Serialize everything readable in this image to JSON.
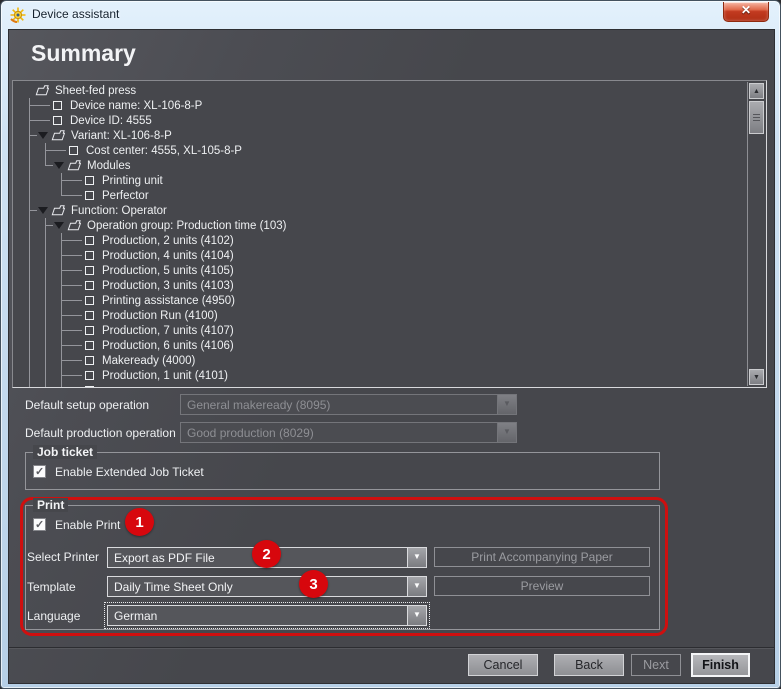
{
  "window": {
    "title": "Device assistant"
  },
  "heading": "Summary",
  "tree": {
    "items": [
      {
        "label": "Sheet-fed press",
        "level": 0,
        "icon": "folder",
        "arrow": false
      },
      {
        "label": "Device name: XL-106-8-P",
        "level": 1,
        "icon": "checkbox",
        "arrow": false
      },
      {
        "label": "Device ID: 4555",
        "level": 1,
        "icon": "checkbox",
        "arrow": false
      },
      {
        "label": "Variant: XL-106-8-P",
        "level": 1,
        "icon": "folder",
        "arrow": true
      },
      {
        "label": "Cost center: 4555, XL-105-8-P",
        "level": 2,
        "icon": "checkbox",
        "arrow": false
      },
      {
        "label": "Modules",
        "level": 2,
        "icon": "folder",
        "arrow": true
      },
      {
        "label": "Printing unit",
        "level": 3,
        "icon": "checkbox",
        "arrow": false
      },
      {
        "label": "Perfector",
        "level": 3,
        "icon": "checkbox",
        "arrow": false
      },
      {
        "label": "Function: Operator",
        "level": 1,
        "icon": "folder",
        "arrow": true
      },
      {
        "label": "Operation group: Production time (103)",
        "level": 2,
        "icon": "folder",
        "arrow": true
      },
      {
        "label": "Production, 2 units (4102)",
        "level": 3,
        "icon": "checkbox",
        "arrow": false
      },
      {
        "label": "Production, 4 units (4104)",
        "level": 3,
        "icon": "checkbox",
        "arrow": false
      },
      {
        "label": "Production, 5 units (4105)",
        "level": 3,
        "icon": "checkbox",
        "arrow": false
      },
      {
        "label": "Production, 3 units (4103)",
        "level": 3,
        "icon": "checkbox",
        "arrow": false
      },
      {
        "label": "Printing assistance (4950)",
        "level": 3,
        "icon": "checkbox",
        "arrow": false
      },
      {
        "label": "Production Run (4100)",
        "level": 3,
        "icon": "checkbox",
        "arrow": false
      },
      {
        "label": "Production, 7 units (4107)",
        "level": 3,
        "icon": "checkbox",
        "arrow": false
      },
      {
        "label": "Production, 6 units (4106)",
        "level": 3,
        "icon": "checkbox",
        "arrow": false
      },
      {
        "label": "Makeready (4000)",
        "level": 3,
        "icon": "checkbox",
        "arrow": false
      },
      {
        "label": "Production, 1 unit (4101)",
        "level": 3,
        "icon": "checkbox",
        "arrow": false
      },
      {
        "label": "",
        "level": 3,
        "icon": "checkbox",
        "arrow": false
      }
    ]
  },
  "form": {
    "default_setup": {
      "label": "Default setup operation",
      "value": "General makeready (8095)",
      "enabled": false
    },
    "default_production": {
      "label": "Default production operation",
      "value": "Good production (8029)",
      "enabled": false
    }
  },
  "job_ticket": {
    "title": "Job ticket",
    "checkbox_label": "Enable Extended Job Ticket",
    "checked": true
  },
  "print": {
    "title": "Print",
    "enable": {
      "label": "Enable Print",
      "checked": true,
      "badge": "1"
    },
    "printer": {
      "label": "Select Printer",
      "value": "Export as PDF File",
      "badge": "2",
      "button": "Print Accompanying Paper"
    },
    "template": {
      "label": "Template",
      "value": "Daily Time Sheet Only",
      "badge": "3",
      "button": "Preview"
    },
    "language": {
      "label": "Language",
      "value": "German"
    }
  },
  "footer": {
    "cancel": "Cancel",
    "back": "Back",
    "next": "Next",
    "finish": "Finish"
  },
  "colors": {
    "badge": "#d7070d",
    "annotation": "#cf0f0f",
    "client_bg": "#46474c",
    "titlebar": "#cfe2f3"
  }
}
